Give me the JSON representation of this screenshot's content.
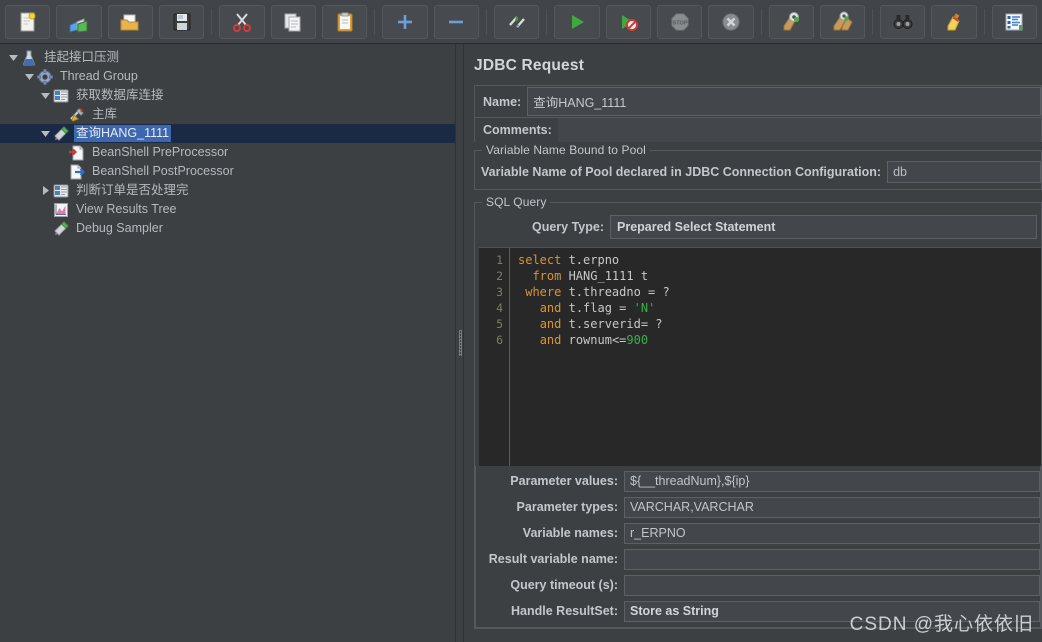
{
  "toolbar": {
    "buttons": [
      {
        "name": "new-button",
        "icon": "new-file-icon",
        "label": "New"
      },
      {
        "name": "templates-button",
        "icon": "templates-icon",
        "label": "Templates"
      },
      {
        "name": "open-button",
        "icon": "open-folder-icon",
        "label": "Open"
      },
      {
        "name": "save-button",
        "icon": "save-floppy-icon",
        "label": "Save Test Plan"
      },
      {
        "name": "cut-button",
        "icon": "scissors-icon",
        "label": "Cut"
      },
      {
        "name": "copy-button",
        "icon": "copy-pages-icon",
        "label": "Copy"
      },
      {
        "name": "paste-button",
        "icon": "clipboard-icon",
        "label": "Paste"
      },
      {
        "name": "expand-all-button",
        "icon": "plus-icon",
        "label": "Expand All"
      },
      {
        "name": "collapse-all-button",
        "icon": "minus-icon",
        "label": "Collapse All"
      },
      {
        "name": "toggle-button",
        "icon": "toggle-pencil-icon",
        "label": "Toggle"
      },
      {
        "name": "start-button",
        "icon": "green-play-icon",
        "label": "Start"
      },
      {
        "name": "start-no-pauses-button",
        "icon": "play-no-pause-icon",
        "label": "Start no pauses"
      },
      {
        "name": "stop-button",
        "icon": "stop-sign-icon",
        "label": "Stop"
      },
      {
        "name": "shutdown-button",
        "icon": "shutdown-x-icon",
        "label": "Shutdown"
      },
      {
        "name": "clear-button",
        "icon": "gear-broom-icon",
        "label": "Clear"
      },
      {
        "name": "clear-all-button",
        "icon": "gear-broom-all-icon",
        "label": "Clear All"
      },
      {
        "name": "search-button",
        "icon": "binoculars-icon",
        "label": "Search"
      },
      {
        "name": "reset-search-button",
        "icon": "broom-icon",
        "label": "Reset Search"
      },
      {
        "name": "function-helper-button",
        "icon": "list-lines-icon",
        "label": "Function Helper Dialog"
      }
    ]
  },
  "tree": {
    "items": [
      {
        "label": "挂起接口压测",
        "icon": "test-plan-icon",
        "depth": 0,
        "expanded": true,
        "has_toggle": true,
        "selected": false
      },
      {
        "label": "Thread Group",
        "icon": "thread-group-icon",
        "depth": 1,
        "expanded": true,
        "has_toggle": true,
        "selected": false
      },
      {
        "label": "获取数据库连接",
        "icon": "jdbc-config-icon",
        "depth": 2,
        "expanded": true,
        "has_toggle": true,
        "selected": false
      },
      {
        "label": "主库",
        "icon": "jdbc-connection-icon",
        "depth": 3,
        "expanded": false,
        "has_toggle": false,
        "selected": false
      },
      {
        "label": "查询HANG_1111",
        "icon": "jdbc-request-icon",
        "depth": 2,
        "expanded": true,
        "has_toggle": true,
        "selected": true
      },
      {
        "label": "BeanShell PreProcessor",
        "icon": "beanshell-pre-icon",
        "depth": 3,
        "expanded": false,
        "has_toggle": false,
        "selected": false
      },
      {
        "label": "BeanShell PostProcessor",
        "icon": "beanshell-post-icon",
        "depth": 3,
        "expanded": false,
        "has_toggle": false,
        "selected": false
      },
      {
        "label": "判断订单是否处理完",
        "icon": "jdbc-config-icon",
        "depth": 2,
        "expanded": false,
        "has_toggle": true,
        "selected": false
      },
      {
        "label": "View Results Tree",
        "icon": "view-results-tree-icon",
        "depth": 2,
        "expanded": false,
        "has_toggle": false,
        "selected": false
      },
      {
        "label": "Debug Sampler",
        "icon": "debug-sampler-icon",
        "depth": 2,
        "expanded": false,
        "has_toggle": false,
        "selected": false
      }
    ]
  },
  "main": {
    "title": "JDBC Request",
    "name_label": "Name:",
    "name_value": "查询HANG_1111",
    "comments_label": "Comments:",
    "comments_value": "",
    "pool_group_title": "Variable Name Bound to Pool",
    "pool_label": "Variable Name of Pool declared in JDBC Connection Configuration:",
    "pool_value": "db",
    "sql_group_title": "SQL Query",
    "query_type_label": "Query Type:",
    "query_type_value": "Prepared Select Statement",
    "sql_lines": [
      {
        "n": "1",
        "tokens": [
          {
            "t": "select",
            "c": "kw"
          },
          {
            "t": " t.erpno",
            "c": "id"
          }
        ]
      },
      {
        "n": "2",
        "tokens": [
          {
            "t": "  ",
            "c": "id"
          },
          {
            "t": "from",
            "c": "kw"
          },
          {
            "t": " HANG_1111 t",
            "c": "id"
          }
        ]
      },
      {
        "n": "3",
        "tokens": [
          {
            "t": " ",
            "c": "id"
          },
          {
            "t": "where",
            "c": "kw"
          },
          {
            "t": " t.threadno = ?",
            "c": "id"
          }
        ]
      },
      {
        "n": "4",
        "tokens": [
          {
            "t": "   ",
            "c": "id"
          },
          {
            "t": "and",
            "c": "kw"
          },
          {
            "t": " t.flag = ",
            "c": "id"
          },
          {
            "t": "'N'",
            "c": "str"
          }
        ]
      },
      {
        "n": "5",
        "tokens": [
          {
            "t": "   ",
            "c": "id"
          },
          {
            "t": "and",
            "c": "kw"
          },
          {
            "t": " t.serverid= ?",
            "c": "id"
          }
        ]
      },
      {
        "n": "6",
        "tokens": [
          {
            "t": "   ",
            "c": "id"
          },
          {
            "t": "and",
            "c": "kw"
          },
          {
            "t": " rownum<=",
            "c": "id"
          },
          {
            "t": "900",
            "c": "num"
          }
        ]
      }
    ],
    "params": [
      {
        "name": "parameter-values",
        "label": "Parameter values:",
        "value": "${__threadNum},${ip}",
        "combo": false
      },
      {
        "name": "parameter-types",
        "label": "Parameter types:",
        "value": "VARCHAR,VARCHAR",
        "combo": false
      },
      {
        "name": "variable-names",
        "label": "Variable names:",
        "value": "r_ERPNO",
        "combo": false
      },
      {
        "name": "result-variable-name",
        "label": "Result variable name:",
        "value": "",
        "combo": false
      },
      {
        "name": "query-timeout",
        "label": "Query timeout (s):",
        "value": "",
        "combo": false
      },
      {
        "name": "handle-resultset",
        "label": "Handle ResultSet:",
        "value": "Store as String",
        "combo": true
      }
    ]
  },
  "watermark": {
    "text": "CSDN @我心依依旧"
  },
  "colors": {
    "panel_bg": "#3c4043",
    "toolbar_bg": "#414549",
    "editor_bg": "#282828",
    "selection_row": "#1b2a44",
    "selection_text": "#3d68b0",
    "keyword": "#d99331",
    "string": "#35b14a",
    "text": "#c8c8c8"
  }
}
